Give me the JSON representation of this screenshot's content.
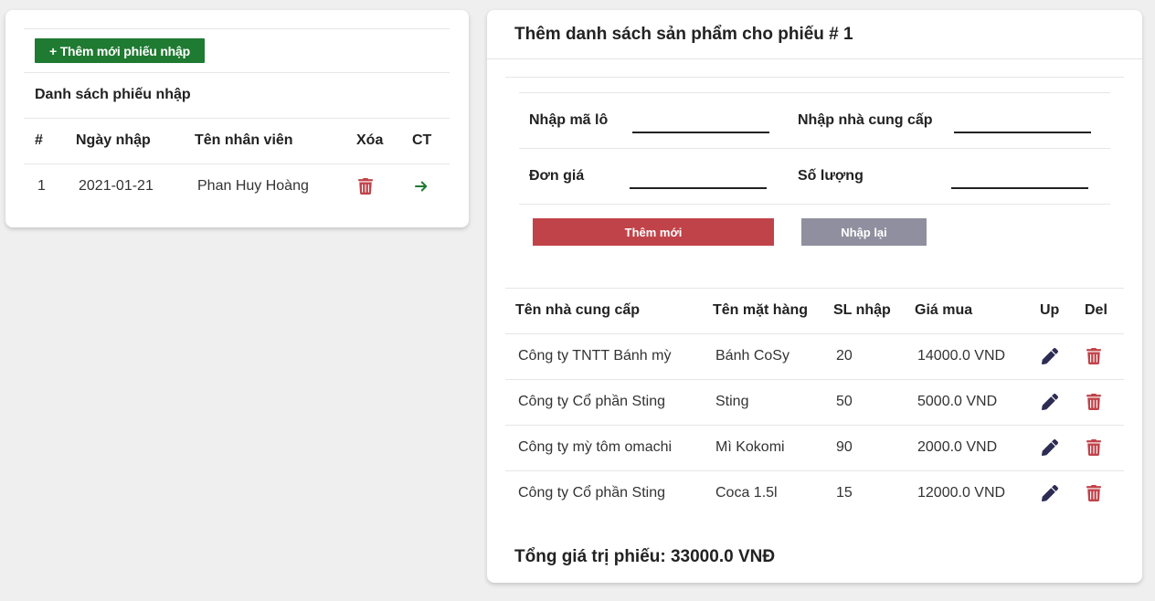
{
  "left_panel": {
    "add_button_label": "+ Thêm mới phiếu nhập",
    "list_title": "Danh sách phiếu nhập",
    "columns": [
      "#",
      "Ngày nhập",
      "Tên nhân viên",
      "Xóa",
      "CT"
    ],
    "rows": [
      {
        "index": "1",
        "date": "2021-01-21",
        "employee": "Phan Huy Hoàng",
        "delete_icon": "trash-icon",
        "detail_icon": "arrow-right-icon"
      }
    ]
  },
  "right_panel": {
    "title": "Thêm danh sách sản phẩm cho phiếu # 1",
    "form": {
      "lot_label": "Nhập mã lô",
      "lot_value": "",
      "supplier_label": "Nhập nhà cung cấp",
      "supplier_value": "",
      "price_label": "Đơn giá",
      "price_value": "",
      "quantity_label": "Số lượng",
      "quantity_value": ""
    },
    "add_button_label": "Thêm mới",
    "reset_button_label": "Nhập lại",
    "columns": [
      "Tên nhà cung cấp",
      "Tên mặt hàng",
      "SL nhập",
      "Giá mua",
      "Up",
      "Del"
    ],
    "rows": [
      {
        "supplier": "Công ty TNTT Bánh mỳ",
        "product": "Bánh CoSy",
        "qty": "20",
        "price": "14000.0 VND"
      },
      {
        "supplier": "Công ty Cổ phần Sting",
        "product": "Sting",
        "qty": "50",
        "price": "5000.0 VND"
      },
      {
        "supplier": "Công ty mỳ tôm omachi",
        "product": "Mì Kokomi",
        "qty": "90",
        "price": "2000.0 VND"
      },
      {
        "supplier": "Công ty Cổ phần Sting",
        "product": "Coca 1.5l",
        "qty": "15",
        "price": "12000.0 VND"
      }
    ],
    "edit_icon": "pencil-icon",
    "delete_icon": "trash-icon",
    "total_text": "Tổng giá trị phiếu: 33000.0 VNĐ"
  },
  "colors": {
    "green_button": "#1f7a32",
    "red_button": "#c1434a",
    "grey_button": "#8f8f9f",
    "trash": "#c1434a",
    "arrow": "#1f7a32",
    "pencil": "#2c2c54"
  }
}
